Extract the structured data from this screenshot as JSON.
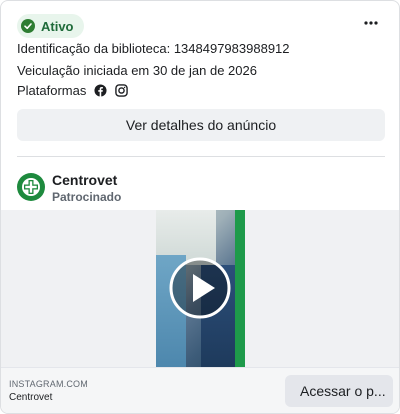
{
  "status": {
    "label": "Ativo",
    "color": "#1f6b3a",
    "badge_bg": "#e8f5ec"
  },
  "menu": {
    "icon": "more-horizontal-icon"
  },
  "ad_info": {
    "library_id": "Identificação da biblioteca: 1348497983988912",
    "started": "Veiculação iniciada em 30 de jan de 2026",
    "platforms_label": "Plataformas",
    "platform_icons": [
      "facebook-icon",
      "instagram-icon"
    ]
  },
  "details_button": {
    "label": "Ver detalhes do anúncio"
  },
  "advertiser": {
    "name": "Centrovet",
    "subtitle": "Patrocinado",
    "avatar_color": "#1e8a3e"
  },
  "media": {
    "type": "video",
    "play_icon": "play-icon"
  },
  "footer": {
    "domain": "INSTAGRAM.COM",
    "name": "Centrovet",
    "cta_label": "Acessar o p..."
  }
}
